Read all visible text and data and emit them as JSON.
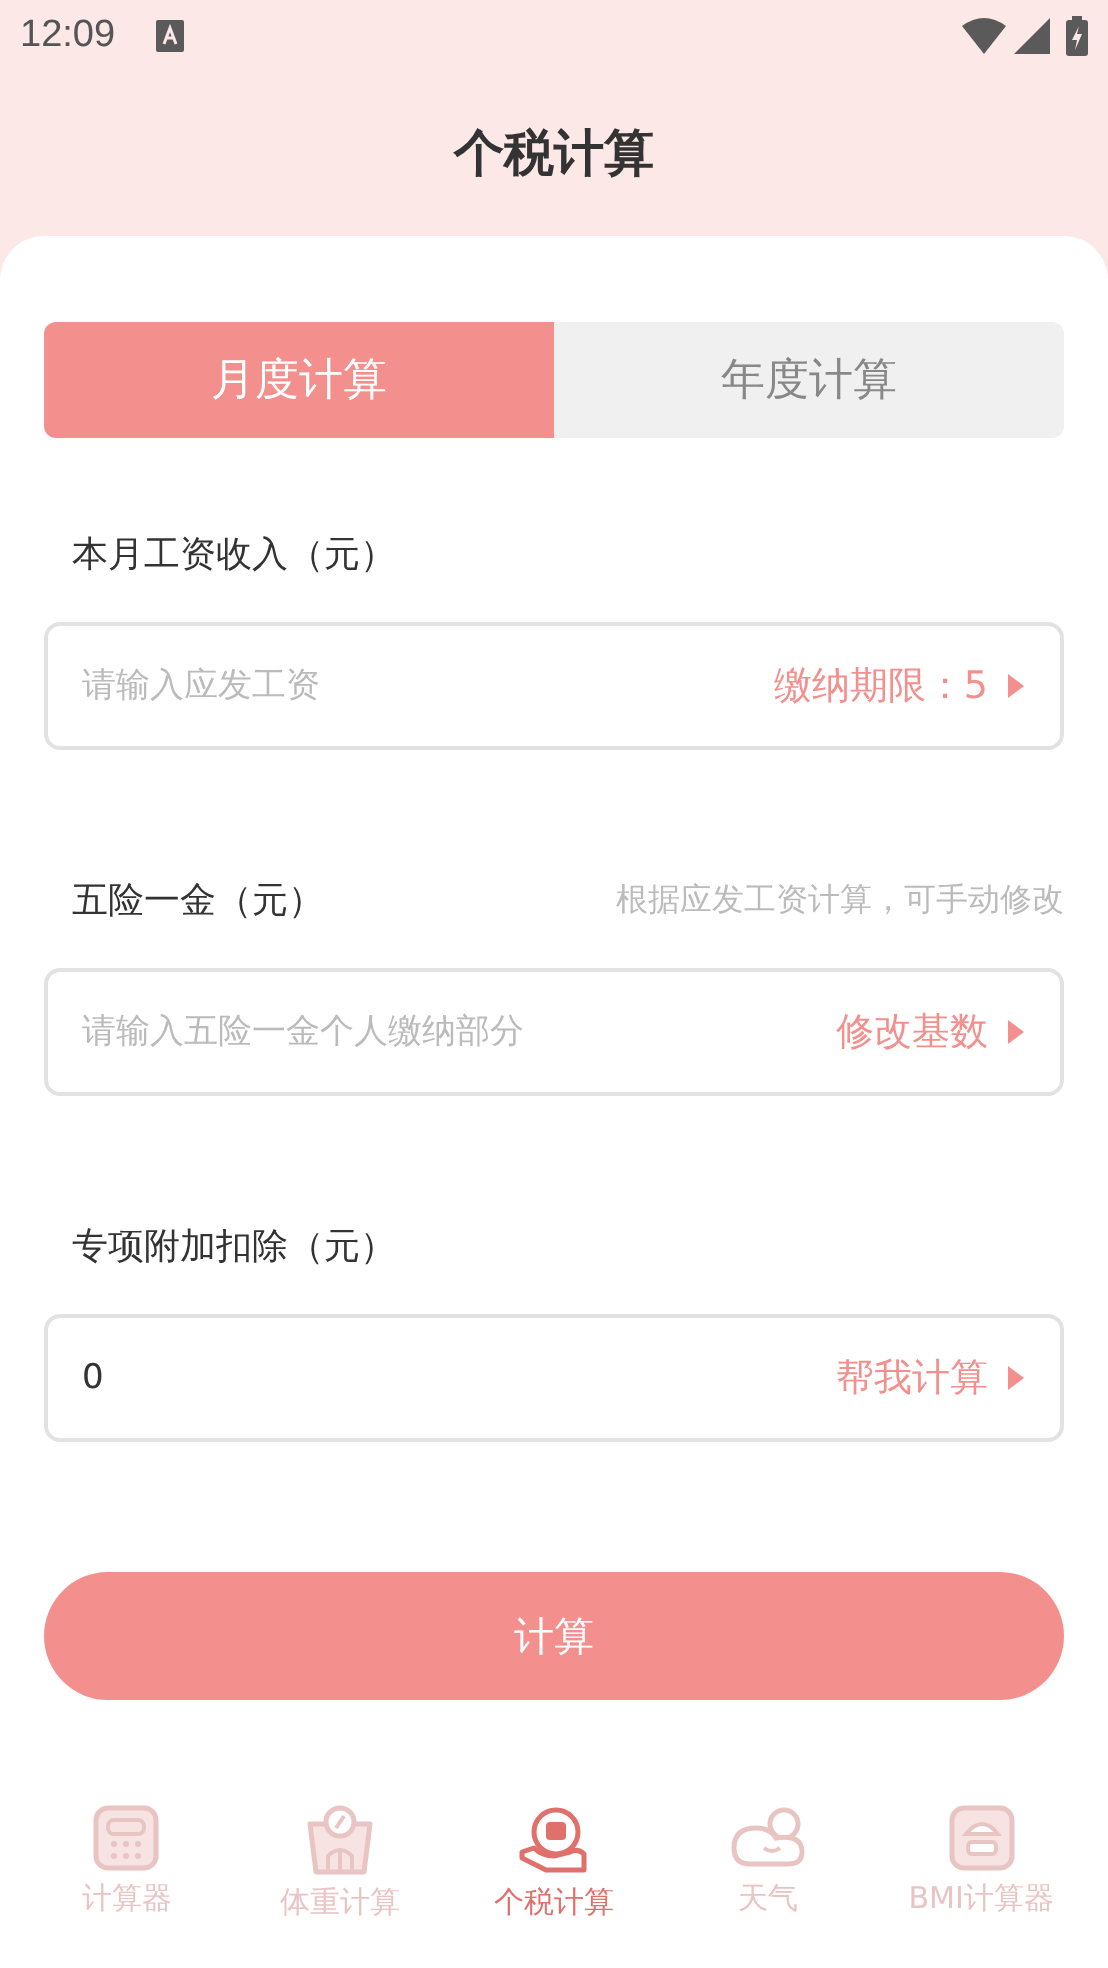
{
  "status_bar": {
    "time": "12:09"
  },
  "title": "个税计算",
  "tabs": [
    {
      "label": "月度计算",
      "selected": true
    },
    {
      "label": "年度计算",
      "selected": false
    }
  ],
  "fields": [
    {
      "label": "本月工资收入（元）",
      "placeholder": "请输入应发工资",
      "action": "缴纳期限：5"
    },
    {
      "label": "五险一金（元）",
      "hint": "根据应发工资计算，可手动修改",
      "placeholder": "请输入五险一金个人缴纳部分",
      "action": "修改基数"
    },
    {
      "label": "专项附加扣除（元）",
      "value": "0",
      "action": "帮我计算"
    }
  ],
  "submit": "计算",
  "nav": [
    {
      "label": "计算器",
      "kind": "calculator",
      "selected": false
    },
    {
      "label": "体重计算",
      "kind": "scale",
      "selected": false
    },
    {
      "label": "个税计算",
      "kind": "tax",
      "selected": true
    },
    {
      "label": "天气",
      "kind": "weather",
      "selected": false
    },
    {
      "label": "BMI计算器",
      "kind": "bmi",
      "selected": false
    }
  ]
}
